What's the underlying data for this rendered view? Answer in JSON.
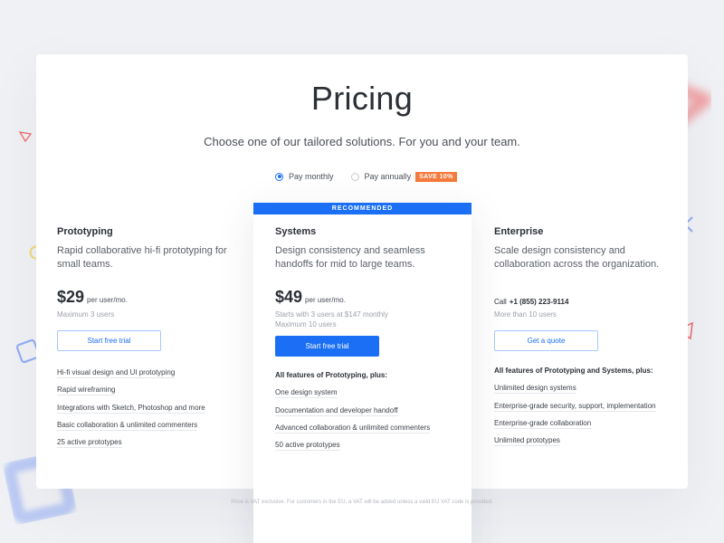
{
  "header": {
    "title": "Pricing",
    "subtitle": "Choose one of our tailored solutions. For you and your team."
  },
  "billing": {
    "monthly_label": "Pay monthly",
    "annually_label": "Pay annually",
    "save_badge": "SAVE 10%",
    "selected": "monthly"
  },
  "plans": [
    {
      "name": "Prototyping",
      "description": "Rapid collaborative hi-fi prototyping for small teams.",
      "price": "$29",
      "price_unit": "per user/mo.",
      "meta": [
        "Maximum 3 users"
      ],
      "button": "Start free trial",
      "features": [
        "Hi-fi visual design and UI prototyping",
        "Rapid wireframing",
        "Integrations with Sketch, Photoshop and more",
        "Basic collaboration & unlimited commenters",
        "25 active prototypes"
      ]
    },
    {
      "name": "Systems",
      "recommended_label": "RECOMMENDED",
      "description": "Design consistency and seamless handoffs for mid to large teams.",
      "price": "$49",
      "price_unit": "per user/mo.",
      "meta": [
        "Starts with 3 users at $147 monthly",
        "Maximum 10 users"
      ],
      "button": "Start free trial",
      "features_heading": "All features of Prototyping, plus:",
      "features": [
        "One design system",
        "Documentation and developer handoff",
        "Advanced collaboration & unlimited commenters",
        "50 active prototypes"
      ]
    },
    {
      "name": "Enterprise",
      "description": "Scale design consistency and collaboration across the organization.",
      "call_label": "Call",
      "phone": "+1 (855) 223-9114",
      "meta": [
        "More than 10 users"
      ],
      "button": "Get a quote",
      "features_heading": "All features of Prototyping and Systems, plus:",
      "features": [
        "Unlimited design systems",
        "Enterprise-grade security, support, implementation",
        "Enterprise-grade collaboration",
        "Unlimited prototypes"
      ]
    }
  ],
  "footer": {
    "note": "Price is VAT exclusive. For customers in the EU, a VAT will be added unless a valid EU VAT code is provided."
  },
  "colors": {
    "accent": "#1a6ff5",
    "badge": "#f57a3d",
    "deco_red": "#f0686b",
    "deco_blue": "#7d9cf5",
    "deco_yellow": "#f0d870"
  }
}
